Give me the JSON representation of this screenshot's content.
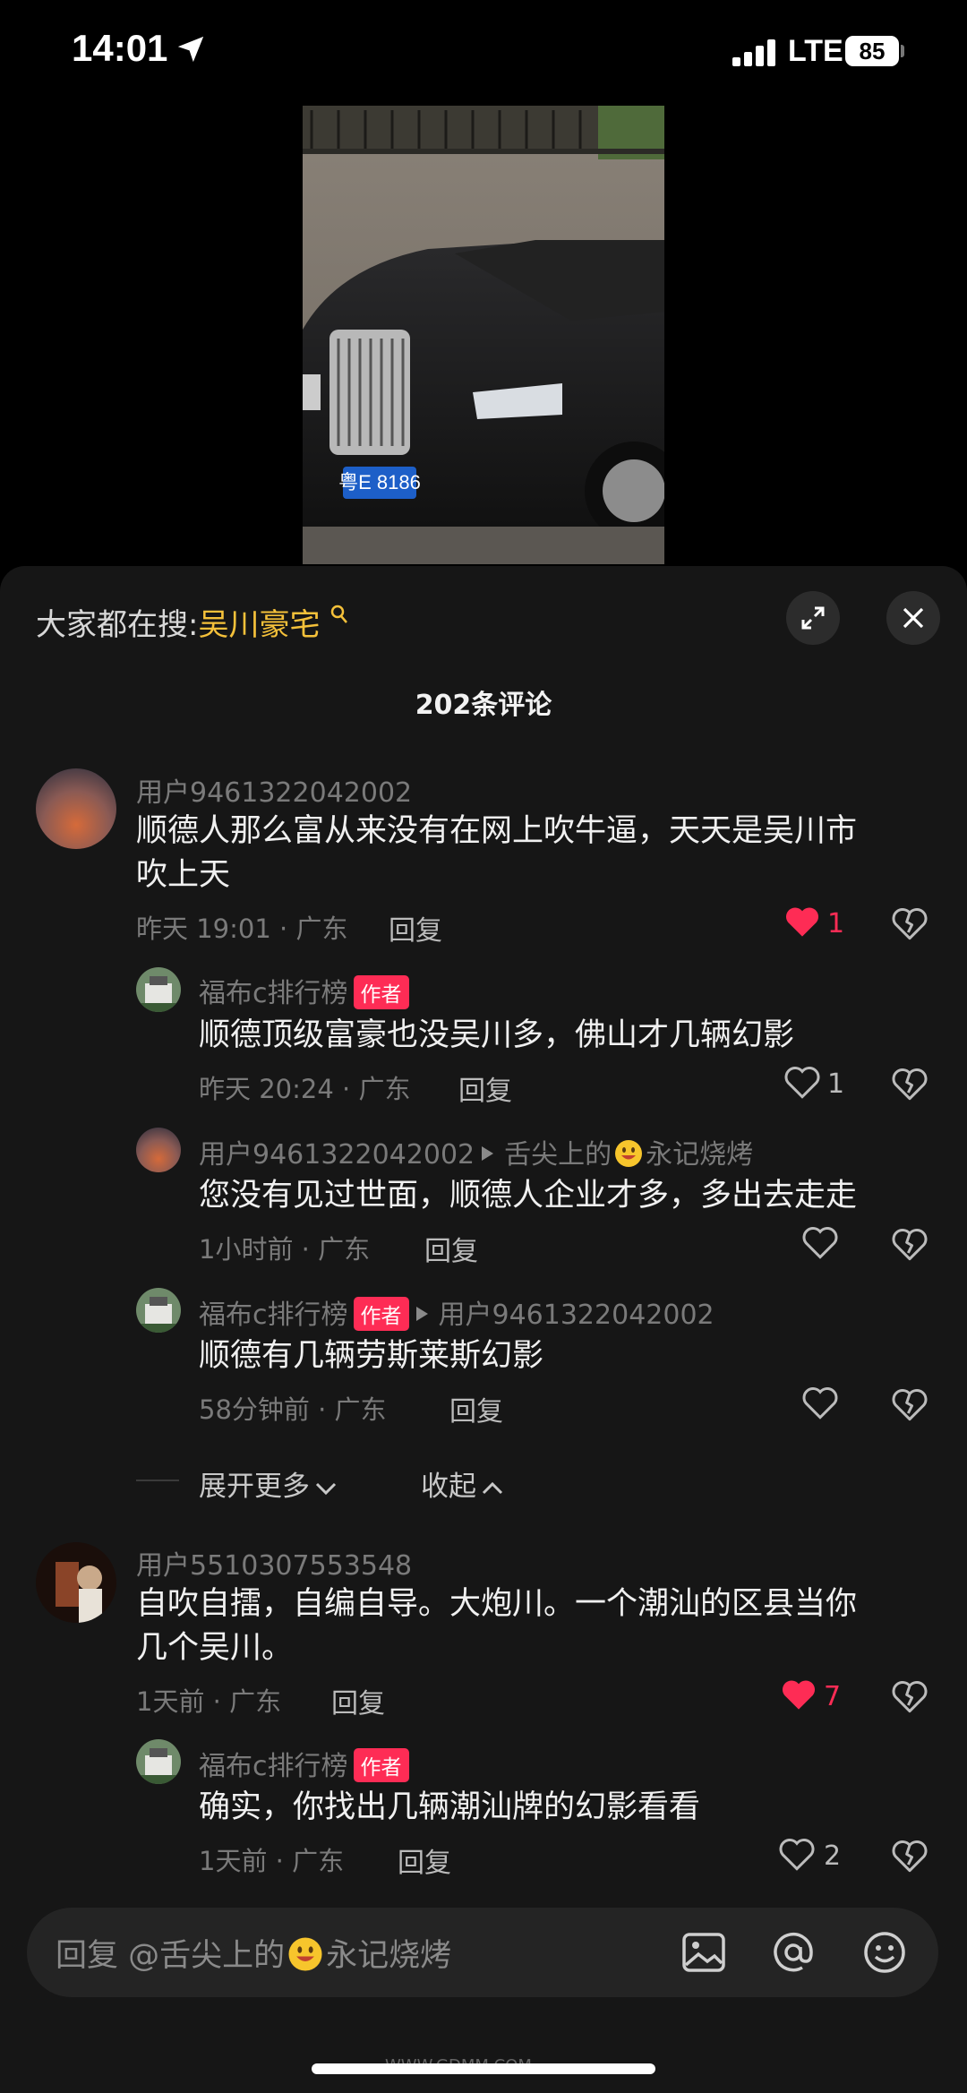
{
  "status_bar": {
    "time": "14:01",
    "network": "LTE",
    "battery": "85"
  },
  "header": {
    "search_prefix": "大家都在搜:",
    "search_term": "吴川豪宅",
    "comment_count": "202条评论"
  },
  "video": {
    "plate": "粤E 8186"
  },
  "comments": [
    {
      "username": "用户9461322042002",
      "text_line1": "顺德人那么富从来没有在网上吹牛逼，天天是吴川市",
      "text_line2": "吹上天",
      "time": "昨天 19:01 · 广东",
      "reply": "回复",
      "likes": "1",
      "liked": true
    },
    {
      "username": "福布c排行榜",
      "badge": "作者",
      "text": "顺德顶级富豪也没吴川多，佛山才几辆幻影",
      "time": "昨天 20:24 · 广东",
      "reply": "回复",
      "likes": "1",
      "liked": false
    },
    {
      "username": "用户9461322042002",
      "reply_to_prefix": "舌尖上的",
      "reply_to_suffix": "永记烧烤",
      "text": "您没有见过世面，顺德人企业才多，多出去走走",
      "time": "1小时前 · 广东",
      "reply": "回复",
      "likes": "",
      "liked": false
    },
    {
      "username": "福布c排行榜",
      "badge": "作者",
      "reply_to": "用户9461322042002",
      "text": "顺德有几辆劳斯莱斯幻影",
      "time": "58分钟前 · 广东",
      "reply": "回复",
      "likes": "",
      "liked": false
    },
    {
      "username": "用户5510307553548",
      "text_line1": "自吹自擂，自编自导。大炮川。一个潮汕的区县当你",
      "text_line2": "几个吴川。",
      "time": "1天前 · 广东",
      "reply": "回复",
      "likes": "7",
      "liked": true
    },
    {
      "username": "福布c排行榜",
      "badge": "作者",
      "text": "确实，你找出几辆潮汕牌的幻影看看",
      "time": "1天前 · 广东",
      "reply": "回复",
      "likes": "2",
      "liked": false
    }
  ],
  "thread_controls": {
    "expand": "展开更多",
    "collapse": "收起"
  },
  "input": {
    "prefix": "回复 @舌尖上的",
    "suffix": "永记烧烤"
  },
  "watermark": "WWW.GDMM.COM",
  "colors": {
    "accent": "#fe2c55",
    "search_term": "#f5c13a",
    "panel": "#161616"
  },
  "icons": [
    "location-arrow-icon",
    "signal-icon",
    "search-icon",
    "expand-icon",
    "close-icon",
    "heart-icon",
    "dislike-icon",
    "chevron-down-icon",
    "chevron-up-icon",
    "image-icon",
    "at-icon",
    "emoji-icon"
  ]
}
